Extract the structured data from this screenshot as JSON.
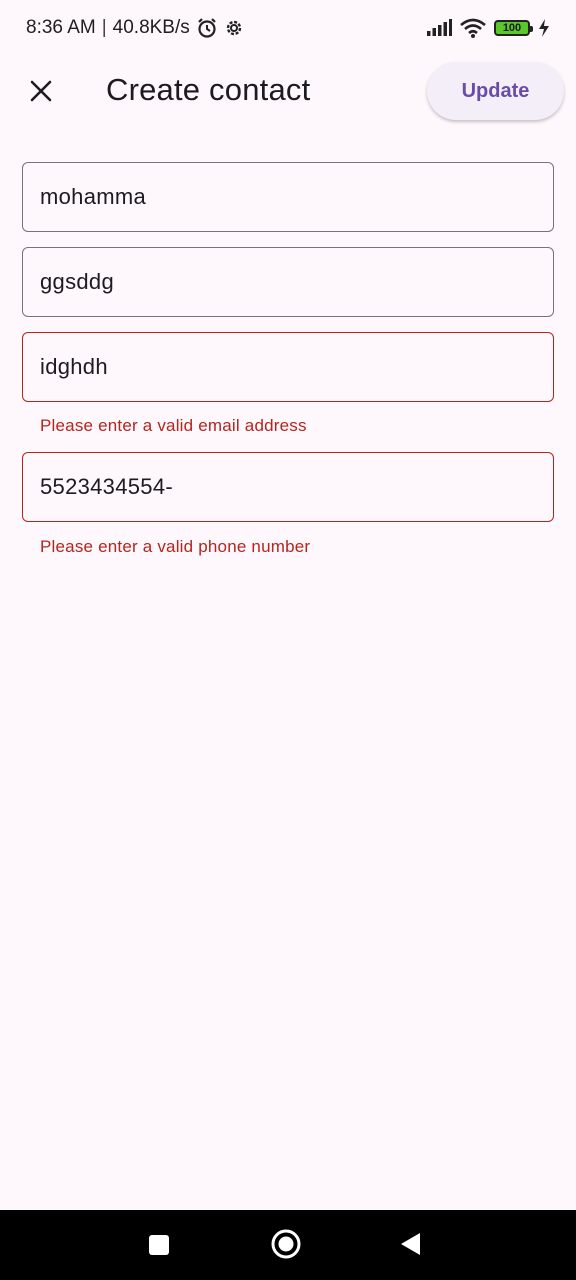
{
  "status_bar": {
    "time": "8:36 AM",
    "separator": "|",
    "speed": "40.8KB/s",
    "battery": "100",
    "icons": [
      "alarm-icon",
      "settings-gear-icon",
      "signal-icon",
      "wifi-icon",
      "battery-icon",
      "charging-bolt-icon"
    ]
  },
  "app_bar": {
    "title": "Create contact",
    "update_label": "Update",
    "close_icon": "close-icon"
  },
  "form": {
    "first_name": {
      "value": "mohamma"
    },
    "last_name": {
      "value": "ggsddg"
    },
    "email": {
      "value": "idghdh",
      "error": "Please enter a valid email address"
    },
    "phone": {
      "value": "5523434554-",
      "error": "Please enter a valid phone number"
    }
  },
  "colors": {
    "background": "#fef7fc",
    "accent": "#6a4ba6",
    "error": "#b3261e",
    "outline": "#77737c"
  },
  "nav_bar": {
    "icons": [
      "recents-square-icon",
      "home-circle-icon",
      "back-triangle-icon"
    ]
  }
}
